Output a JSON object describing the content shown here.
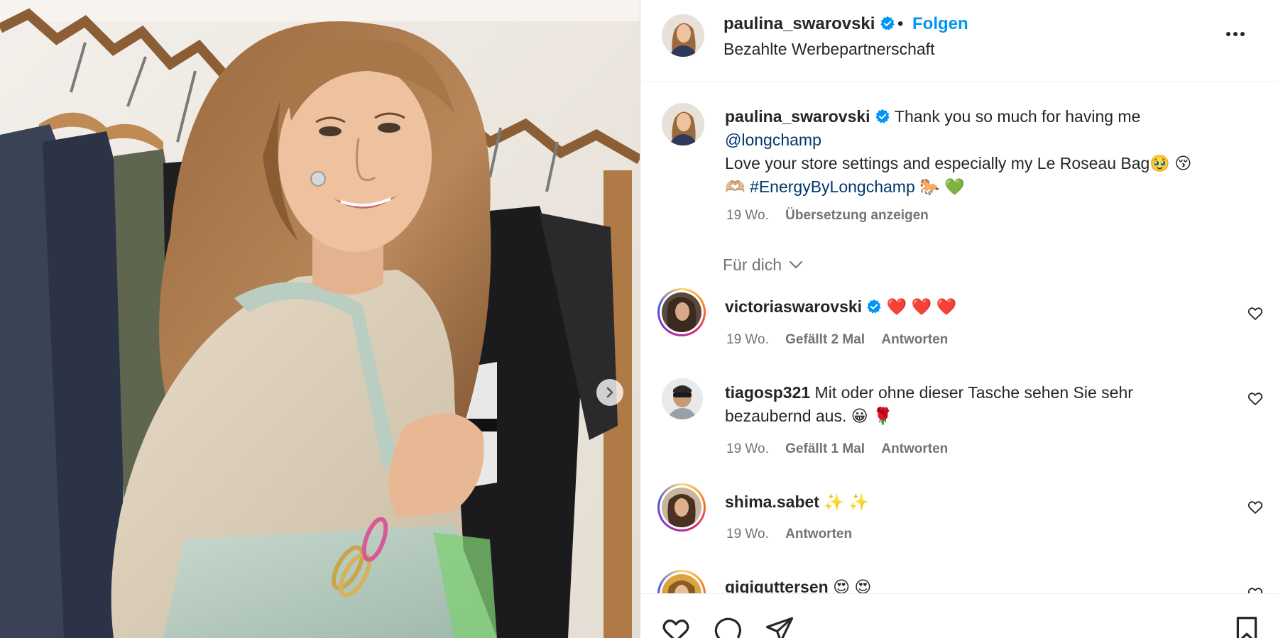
{
  "post": {
    "username": "paulina_swarovski",
    "follow_label": "Folgen",
    "separator": "•",
    "subtitle": "Bezahlte Werbepartnerschaft",
    "more_label": "Weitere Optionen"
  },
  "caption": {
    "username": "paulina_swarovski",
    "line1": "Thank you so much for having me",
    "mention": "@longchamp",
    "line2": "Love your store settings and especially my Le Roseau Bag🥹 😚",
    "emoji_hands": "🫶🏼",
    "hashtag": "#EnergyByLongchamp",
    "emoji_end": "🐎 💚",
    "time": "19 Wo.",
    "translate": "Übersetzung anzeigen"
  },
  "filter": {
    "label": "Für dich"
  },
  "comments": [
    {
      "username": "victoriaswarovski",
      "text": "❤️ ❤️ ❤️",
      "time": "19 Wo.",
      "likes": "Gefällt 2 Mal",
      "reply": "Antworten"
    },
    {
      "username": "tiagosp321",
      "text": "Mit oder ohne dieser Tasche sehen Sie sehr bezaubernd aus. 😀 🌹",
      "time": "19 Wo.",
      "likes": "Gefällt 1 Mal",
      "reply": "Antworten"
    },
    {
      "username": "shima.sabet",
      "text": "✨ ✨",
      "time": "19 Wo.",
      "reply": "Antworten"
    },
    {
      "username": "gigiguttersen",
      "text": "😍 😍"
    }
  ],
  "colors": {
    "accent": "#0095f6",
    "link": "#00376b",
    "muted": "#737373",
    "verified": "#0095f6"
  },
  "icons": {
    "verified": "verified-badge-icon",
    "more": "more-horizontal-icon",
    "heart": "heart-icon",
    "comment": "comment-icon",
    "share": "paper-plane-icon",
    "save": "bookmark-icon",
    "next": "chevron-right-icon"
  }
}
